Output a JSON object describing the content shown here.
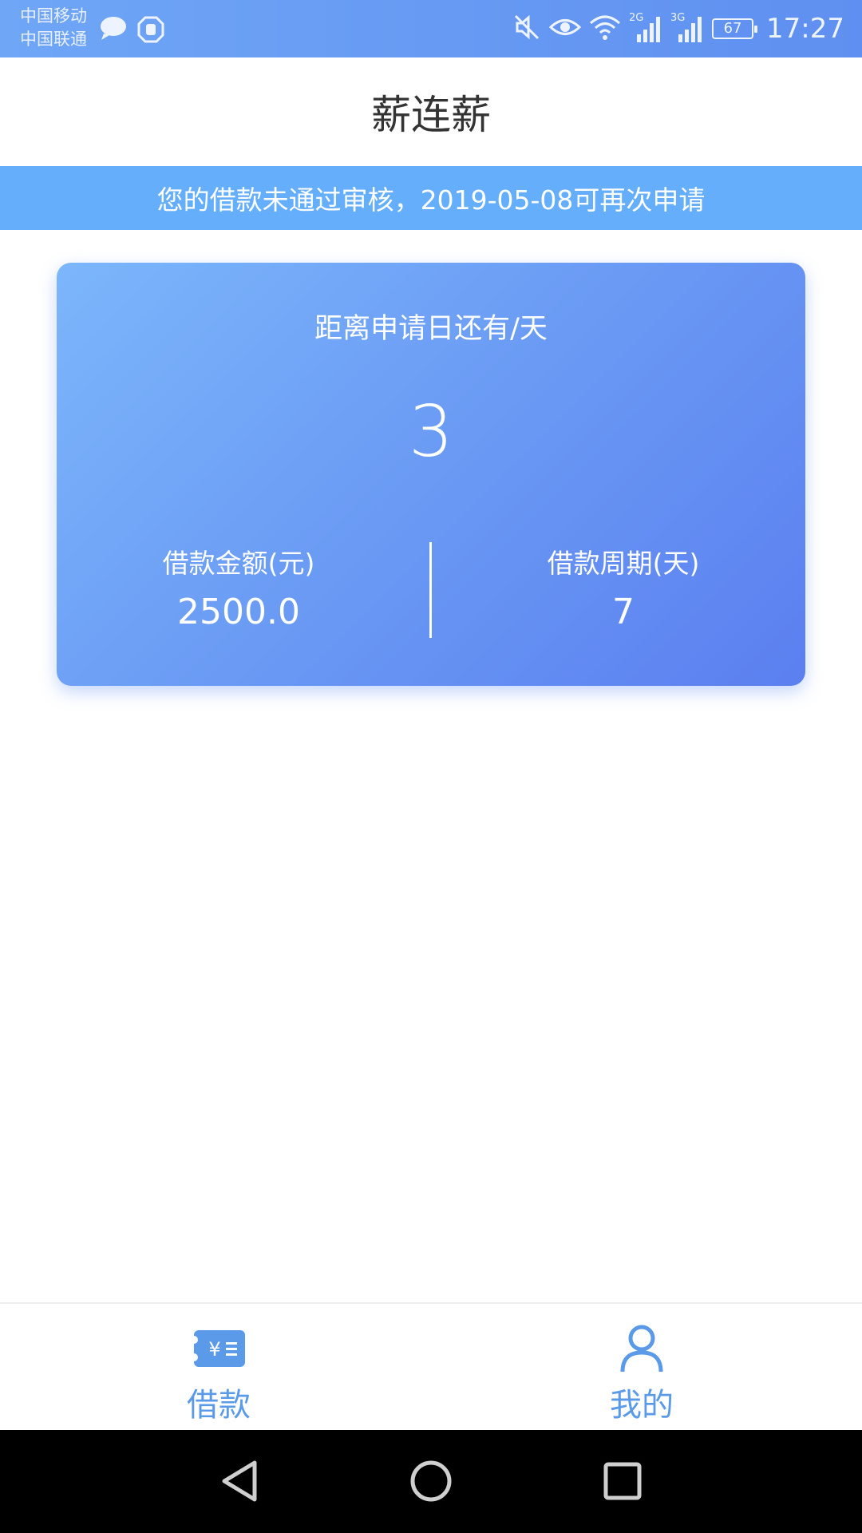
{
  "status_bar": {
    "carrier_1": "中国移动",
    "carrier_2": "中国联通",
    "network_1": "2G",
    "network_2": "3G",
    "battery": "67",
    "time": "17:27",
    "icons": [
      "message-icon",
      "hand-icon",
      "mute-icon",
      "eye-icon",
      "wifi-icon",
      "signal-icon",
      "battery-icon"
    ]
  },
  "header": {
    "title": "薪连薪"
  },
  "notice": {
    "text": "您的借款未通过审核，2019-05-08可再次申请"
  },
  "card": {
    "subtitle": "距离申请日还有/天",
    "days_remaining": "3",
    "amount_label": "借款金额(元)",
    "amount_value": "2500.0",
    "period_label": "借款周期(天)",
    "period_value": "7"
  },
  "tabs": [
    {
      "label": "借款",
      "icon": "loan-icon"
    },
    {
      "label": "我的",
      "icon": "user-icon"
    }
  ],
  "colors": {
    "accent": "#5b9ae8",
    "notice_bg": "#64aefc",
    "card_gradient_start": "#7cb6fb",
    "card_gradient_end": "#5b7ff0"
  }
}
